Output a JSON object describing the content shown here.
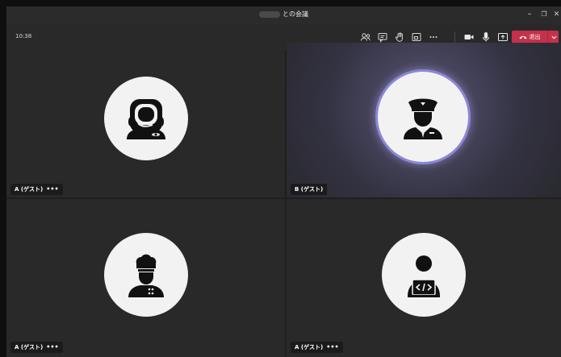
{
  "window": {
    "title": "との会議",
    "controls": {
      "minimize": "–",
      "restore": "❐",
      "close": "✕"
    }
  },
  "toolbar": {
    "time": "10:38",
    "leave_label": "退出",
    "icons": [
      "people-icon",
      "chat-icon",
      "raise-hand-icon",
      "rooms-icon",
      "more-icon",
      "camera-icon",
      "mic-icon",
      "share-icon"
    ]
  },
  "participants": [
    {
      "name": "A (ゲスト)",
      "more": "•••",
      "avatar": "astronaut-icon",
      "speaking": false
    },
    {
      "name": "B (ゲスト)",
      "more": "",
      "avatar": "pilot-icon",
      "speaking": true
    },
    {
      "name": "A (ゲスト)",
      "more": "•••",
      "avatar": "chef-icon",
      "speaking": false
    },
    {
      "name": "A (ゲスト)",
      "more": "•••",
      "avatar": "developer-icon",
      "speaking": false
    }
  ],
  "colors": {
    "leave": "#c4314b",
    "speaking_ring": "#8b87d6",
    "tile": "#292929"
  }
}
